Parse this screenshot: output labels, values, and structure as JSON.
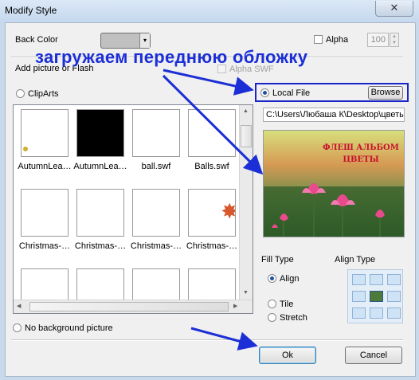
{
  "window": {
    "title": "Modify Style",
    "close_glyph": "✕"
  },
  "back_color": {
    "label": "Back Color",
    "swatch_color": "#c0c0c0"
  },
  "alpha": {
    "label": "Alpha",
    "value": "100",
    "checked": false
  },
  "add_picture": {
    "label": "Add picture or Flash"
  },
  "alpha_swf": {
    "label": "Alpha SWF"
  },
  "annotation": {
    "text": "загружаем переднюю обложку",
    "color": "#1c2fd6"
  },
  "source": {
    "cliparts_label": "ClipArts",
    "local_file_label": "Local File",
    "selected": "local_file"
  },
  "browse": {
    "label": "Browse"
  },
  "file_path": {
    "value": "C:\\Users\\Любаша К\\Desktop\\цветы"
  },
  "preview": {
    "line1": "ФЛЕШ АЛЬБОМ",
    "line2": "ЦВЕТЫ"
  },
  "cliparts": {
    "items": [
      {
        "label": "AutumnLea…",
        "kind": "leaf-corner"
      },
      {
        "label": "AutumnLea…",
        "kind": "black"
      },
      {
        "label": "ball.swf",
        "kind": "blank"
      },
      {
        "label": "Balls.swf",
        "kind": "blank"
      },
      {
        "label": "Christmas-…",
        "kind": "blank"
      },
      {
        "label": "Christmas-…",
        "kind": "blank"
      },
      {
        "label": "Christmas-…",
        "kind": "blank"
      },
      {
        "label": "Christmas-…",
        "kind": "star-corner"
      },
      {
        "label": "",
        "kind": "blank"
      },
      {
        "label": "",
        "kind": "blank"
      },
      {
        "label": "",
        "kind": "blank"
      },
      {
        "label": "",
        "kind": "blank"
      }
    ]
  },
  "fill_type": {
    "label": "Fill Type",
    "options": [
      "Align",
      "Tile",
      "Stretch"
    ],
    "selected": "Align"
  },
  "align_type": {
    "label": "Align Type"
  },
  "no_background": {
    "label": "No background picture"
  },
  "buttons": {
    "ok": "Ok",
    "cancel": "Cancel"
  }
}
